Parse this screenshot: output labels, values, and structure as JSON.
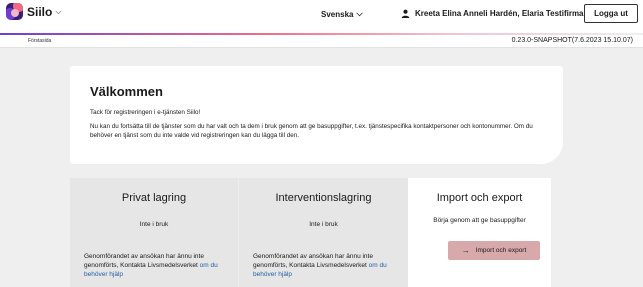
{
  "header": {
    "logo_text": "Siilo",
    "language": "Svenska",
    "user": "Kreeta Elina Anneli Hardén, Elaria Testifirma",
    "logout_label": "Logga ut"
  },
  "breadcrumb": {
    "current": "Förstasida"
  },
  "version": "0.23.0-SNAPSHOT(7.6.2023 15.10.07)",
  "welcome": {
    "title": "Välkommen",
    "thanks": "Tack för registreringen i e-tjänsten Siilo!",
    "body": "Nu kan du fortsätta till de tjänster som du har valt och ta dem i bruk genom att ge basuppgifter, t.ex. tjänstespecifika kontaktpersoner och kontonummer. Om du behöver en tjänst som du inte valde vid registreringen kan du lägga till den."
  },
  "cards": [
    {
      "title": "Privat lagring",
      "status": "Inte i bruk",
      "note": "Genomförandet av ansökan har ännu inte genomförts, Kontakta Livsmedelsverket ",
      "link": "om du behöver hjälp"
    },
    {
      "title": "Interventionslagring",
      "status": "Inte i bruk",
      "note": "Genomförandet av ansökan har ännu inte genomförts, Kontakta Livsmedelsverket ",
      "link": "om du behöver hjälp"
    },
    {
      "title": "Import och export",
      "status": "Börja genom att ge basuppgifter",
      "button_label": "Import och export"
    }
  ],
  "icons": {
    "chevron": "chevron-down-icon",
    "user": "user-icon",
    "arrow": "arrow-right-icon"
  },
  "colors": {
    "brand_purple": "#6d3fd1",
    "brand_pink": "#f06a86",
    "import_button": "#d8a9aa",
    "link": "#1f5fa8"
  }
}
